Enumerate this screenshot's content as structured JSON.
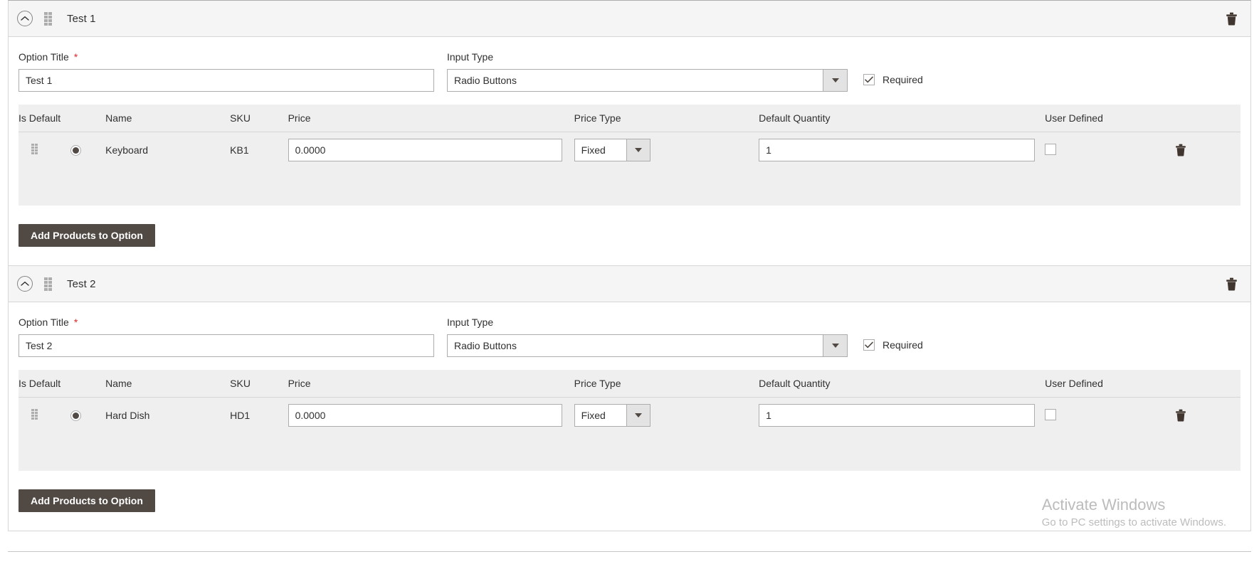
{
  "accent_color": "#514943",
  "required_star_color": "#e22626",
  "table_header_bg": "#efefef",
  "icons": {
    "collapse": "chevron-up-circle-icon",
    "drag": "drag-handle-icon",
    "delete": "trash-icon",
    "dropdown": "chevron-down-icon"
  },
  "table_headers": {
    "is_default": "Is Default",
    "name": "Name",
    "sku": "SKU",
    "price": "Price",
    "price_type": "Price Type",
    "default_quantity": "Default Quantity",
    "user_defined": "User Defined"
  },
  "labels": {
    "option_title": "Option Title",
    "required_mark": "*",
    "input_type": "Input Type",
    "required_checkbox": "Required",
    "add_products_button": "Add Products to Option"
  },
  "sections": [
    {
      "header_title": "Test 1",
      "option_title_value": "Test 1",
      "option_title_placeholder": "Option Title",
      "input_type_value": "Radio Buttons",
      "required_checked": true,
      "rows": [
        {
          "is_default_selected": true,
          "name": "Keyboard",
          "sku": "KB1",
          "price": "0.0000",
          "price_placeholder": "0.0000",
          "price_type": "Fixed",
          "default_quantity": "1",
          "qty_placeholder": "1",
          "user_defined_checked": false
        }
      ]
    },
    {
      "header_title": "Test 2",
      "option_title_value": "Test 2",
      "option_title_placeholder": "Option Title",
      "input_type_value": "Radio Buttons",
      "required_checked": true,
      "rows": [
        {
          "is_default_selected": true,
          "name": "Hard Dish",
          "sku": "HD1",
          "price": "0.0000",
          "price_placeholder": "0.0000",
          "price_type": "Fixed",
          "default_quantity": "1",
          "qty_placeholder": "1",
          "user_defined_checked": false
        }
      ]
    }
  ],
  "watermark": {
    "title": "Activate Windows",
    "subtitle": "Go to PC settings to activate Windows."
  }
}
